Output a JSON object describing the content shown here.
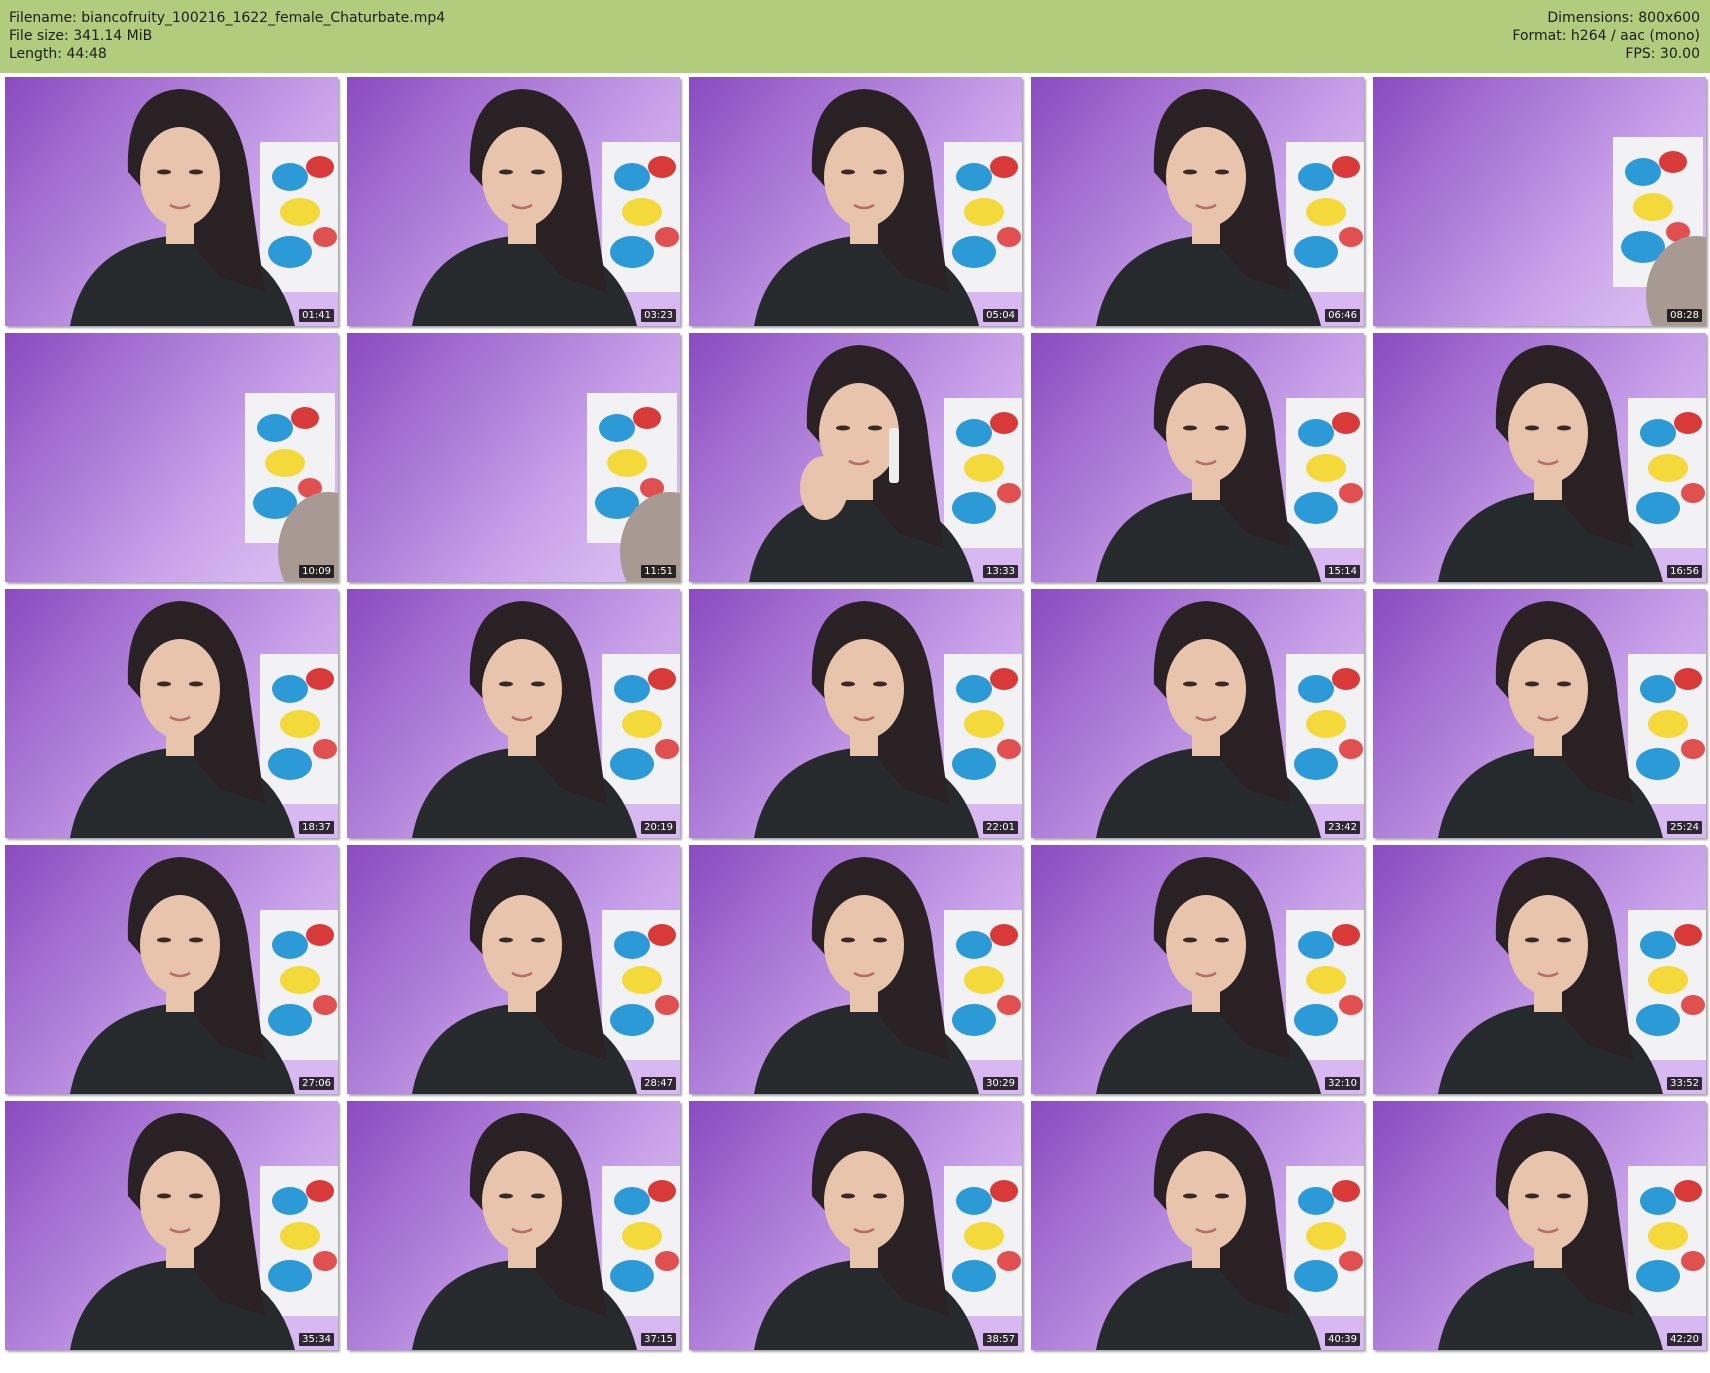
{
  "header": {
    "filename": "Filename: biancofruity_100216_1622_female_Chaturbate.mp4",
    "filesize": "File size: 341.14 MiB",
    "length": "Length: 44:48",
    "dimensions": "Dimensions: 800x600",
    "format": "Format: h264 / aac (mono)",
    "fps": "FPS: 30.00"
  },
  "colors": {
    "header_bg": "#b2cc7d",
    "wall_purple": "#8a4bc0",
    "wall_light": "#c9a3ea",
    "hair": "#2a2124",
    "skin": "#e9c4ad",
    "sweater": "#262a2c"
  },
  "thumbnails": [
    {
      "time": "01:41",
      "scene": "person"
    },
    {
      "time": "03:23",
      "scene": "person"
    },
    {
      "time": "05:04",
      "scene": "person"
    },
    {
      "time": "06:46",
      "scene": "person"
    },
    {
      "time": "08:28",
      "scene": "empty"
    },
    {
      "time": "10:09",
      "scene": "empty"
    },
    {
      "time": "11:51",
      "scene": "empty"
    },
    {
      "time": "13:33",
      "scene": "phone"
    },
    {
      "time": "15:14",
      "scene": "person"
    },
    {
      "time": "16:56",
      "scene": "person"
    },
    {
      "time": "18:37",
      "scene": "person"
    },
    {
      "time": "20:19",
      "scene": "person"
    },
    {
      "time": "22:01",
      "scene": "person"
    },
    {
      "time": "23:42",
      "scene": "person"
    },
    {
      "time": "25:24",
      "scene": "person"
    },
    {
      "time": "27:06",
      "scene": "person"
    },
    {
      "time": "28:47",
      "scene": "person"
    },
    {
      "time": "30:29",
      "scene": "person"
    },
    {
      "time": "32:10",
      "scene": "person"
    },
    {
      "time": "33:52",
      "scene": "person"
    },
    {
      "time": "35:34",
      "scene": "person"
    },
    {
      "time": "37:15",
      "scene": "person"
    },
    {
      "time": "38:57",
      "scene": "person"
    },
    {
      "time": "40:39",
      "scene": "person"
    },
    {
      "time": "42:20",
      "scene": "person"
    }
  ]
}
